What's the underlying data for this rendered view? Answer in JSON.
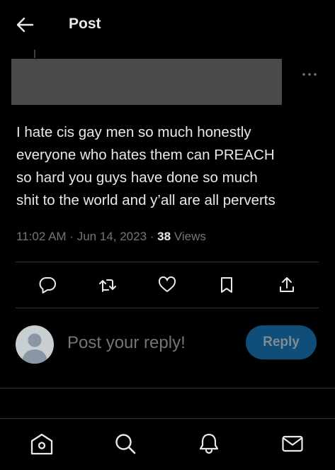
{
  "header": {
    "title": "Post",
    "back_icon": "arrow-left-icon"
  },
  "post": {
    "author": "[redacted]",
    "more_icon": "more-horizontal-icon",
    "text": "I hate cis gay men so much honestly\neveryone who hates them can PREACH\nso hard you guys have done so much\nshit to the world and y’all are all perverts",
    "time": "11:02 AM",
    "separator": "·",
    "date": "Jun 14, 2023",
    "views_count": "38",
    "views_label": "Views"
  },
  "actions": [
    {
      "name": "reply-action",
      "icon": "comment-icon"
    },
    {
      "name": "repost-action",
      "icon": "repost-icon"
    },
    {
      "name": "like-action",
      "icon": "heart-icon"
    },
    {
      "name": "bookmark-action",
      "icon": "bookmark-icon"
    },
    {
      "name": "share-action",
      "icon": "share-icon"
    }
  ],
  "reply": {
    "placeholder": "Post your reply!",
    "button_label": "Reply"
  },
  "nav": [
    {
      "name": "nav-home",
      "icon": "home-icon"
    },
    {
      "name": "nav-search",
      "icon": "search-icon"
    },
    {
      "name": "nav-notifications",
      "icon": "bell-icon"
    },
    {
      "name": "nav-messages",
      "icon": "mail-icon"
    }
  ],
  "colors": {
    "background": "#000000",
    "text": "#e7e9ea",
    "muted": "#71767b",
    "divider": "#2f3336",
    "reply_button_bg": "#0f4e78",
    "reply_button_text": "#808a92",
    "redaction": "#4a4a4a"
  }
}
